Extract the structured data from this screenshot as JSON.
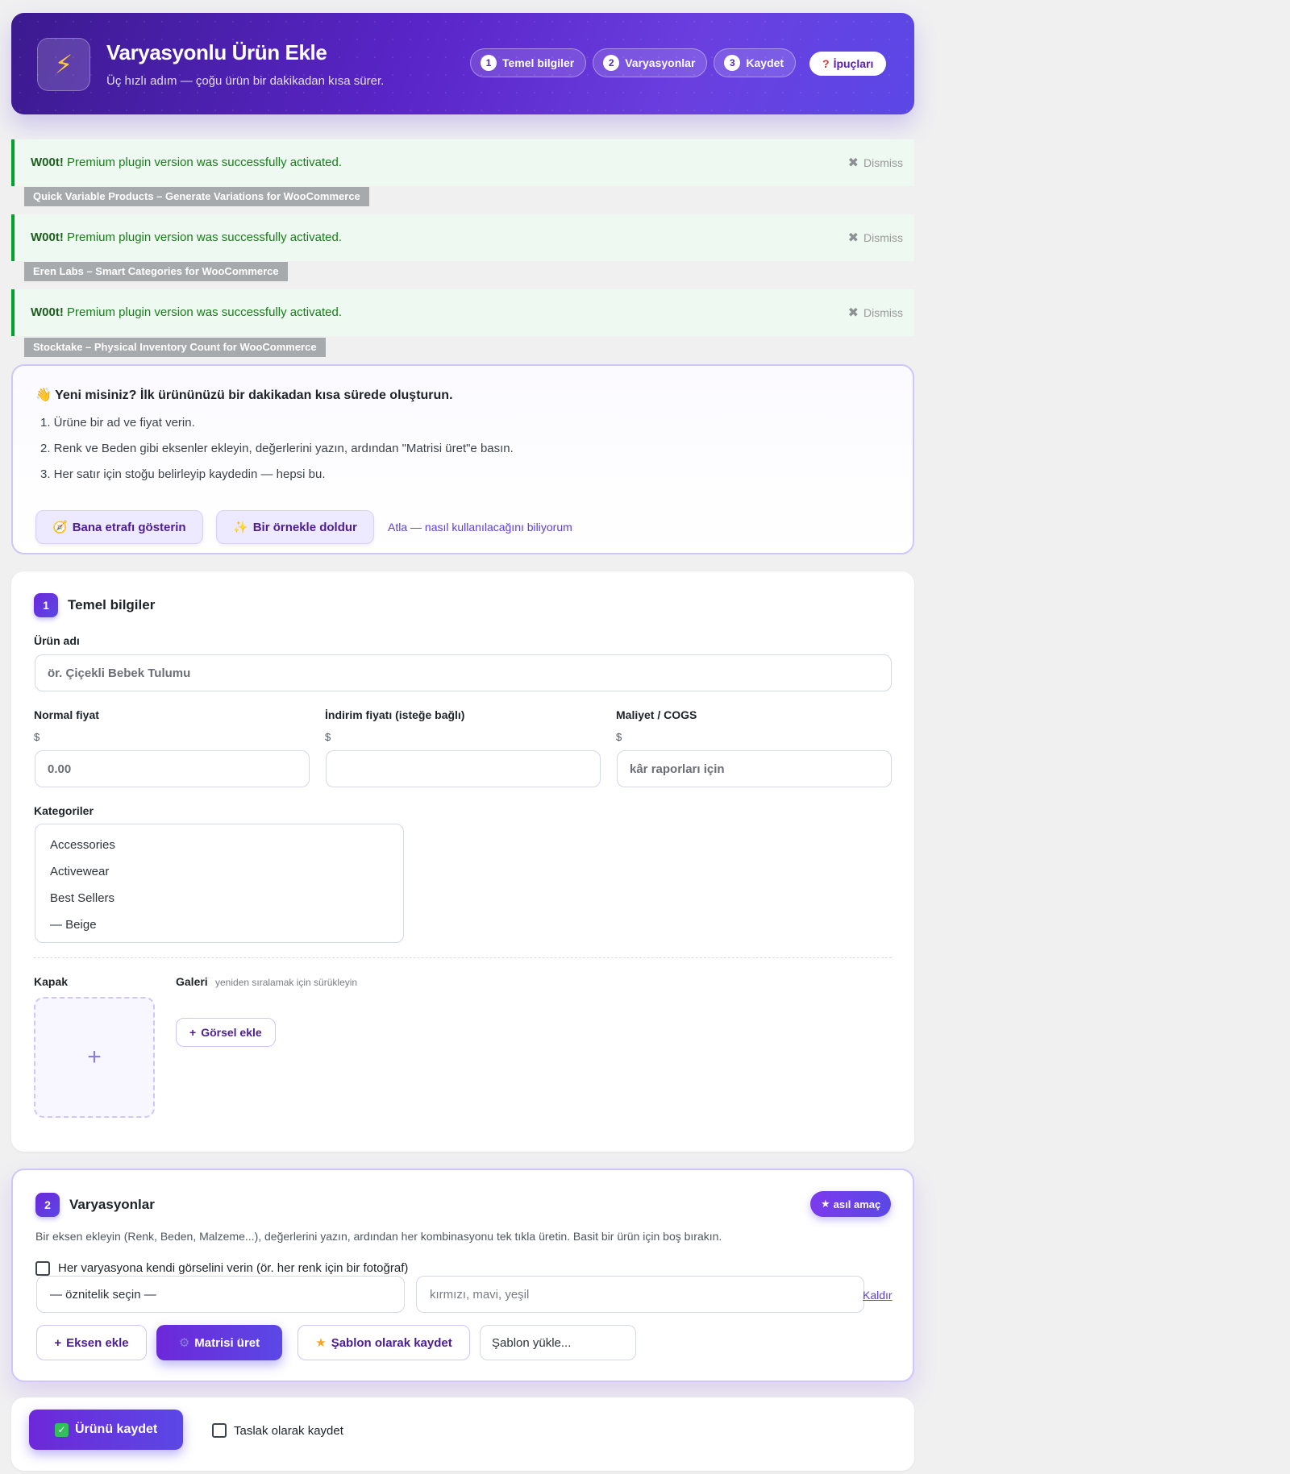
{
  "hero": {
    "icon": "lightning-icon",
    "title": "Varyasyonlu Ürün Ekle",
    "subtitle": "Üç hızlı adım — çoğu ürün bir dakikadan kısa sürer.",
    "steps": [
      {
        "num": "1",
        "label": "Temel bilgiler"
      },
      {
        "num": "2",
        "label": "Varyasyonlar"
      },
      {
        "num": "3",
        "label": "Kaydet"
      }
    ],
    "tips_icon": "?",
    "tips_label": "İpuçları"
  },
  "notices": [
    {
      "strong": "W00t!",
      "text": " Premium plugin version was successfully activated.",
      "dismiss": "Dismiss",
      "tag": "Quick Variable Products – Generate Variations for WooCommerce"
    },
    {
      "strong": "W00t!",
      "text": " Premium plugin version was successfully activated.",
      "dismiss": "Dismiss",
      "tag": "Eren Labs – Smart Categories for WooCommerce"
    },
    {
      "strong": "W00t!",
      "text": " Premium plugin version was successfully activated.",
      "dismiss": "Dismiss",
      "tag": "Stocktake – Physical Inventory Count for WooCommerce"
    }
  ],
  "onboarding": {
    "emoji": "👋",
    "title": "Yeni misiniz? İlk ürününüzü bir dakikadan kısa sürede oluşturun.",
    "steps": [
      "1. Ürüne bir ad ve fiyat verin.",
      "2. Renk ve Beden gibi eksenler ekleyin, değerlerini yazın, ardından \"Matrisi üret\"e basın.",
      "3. Her satır için stoğu belirleyip kaydedin — hepsi bu."
    ],
    "tour_label": "Bana etrafı gösterin",
    "example_label": "Bir örnekle doldur",
    "skip_label": "Atla — nasıl kullanılacağını biliyorum"
  },
  "basics": {
    "num": "1",
    "title": "Temel bilgiler",
    "name_label": "Ürün adı",
    "name_placeholder": "ör. Çiçekli Bebek Tulumu",
    "regular_label": "Normal fiyat",
    "regular_currency": "$",
    "regular_value": "0.00",
    "sale_label": "İndirim fiyatı (isteğe bağlı)",
    "sale_currency": "$",
    "sale_value": "",
    "cost_label": "Maliyet / COGS",
    "cost_currency": "$",
    "cost_placeholder": "kâr raporları için",
    "categories_label": "Kategoriler",
    "categories": [
      "Accessories",
      "Activewear",
      "Best Sellers",
      "— Beige"
    ],
    "cover_label": "Kapak",
    "cover_plus": "+",
    "gallery_label": "Galeri",
    "gallery_hint": "yeniden sıralamak için sürükleyin",
    "add_image_label": "Görsel ekle"
  },
  "variations": {
    "num": "2",
    "title": "Varyasyonlar",
    "badge": "asıl amaç",
    "description": "Bir eksen ekleyin (Renk, Beden, Malzeme...), değerlerini yazın, ardından her kombinasyonu tek tıkla üretin. Basit bir ürün için boş bırakın.",
    "per_image_label": "Her varyasyona kendi görselini verin (ör. her renk için bir fotoğraf)",
    "attribute_select": "— öznitelik seçin —",
    "values_placeholder": "kırmızı, mavi, yeşil",
    "remove_label": "Kaldır",
    "add_axis_label": "Eksen ekle",
    "generate_label": "Matrisi üret",
    "save_template_label": "Şablon olarak kaydet",
    "load_template_label": "Şablon yükle..."
  },
  "savebar": {
    "save_label": "Ürünü kaydet",
    "draft_label": "Taslak olarak kaydet"
  }
}
